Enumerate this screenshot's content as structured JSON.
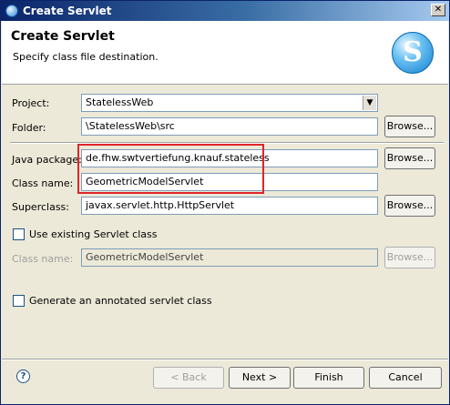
{
  "window": {
    "title": "Create Servlet"
  },
  "banner": {
    "heading": "Create Servlet",
    "description": "Specify class file destination."
  },
  "form": {
    "project": {
      "label": "Project:",
      "value": "StatelessWeb"
    },
    "folder": {
      "label": "Folder:",
      "value": "\\StatelessWeb\\src",
      "browse": "Browse..."
    },
    "package": {
      "label": "Java package:",
      "value": "de.fhw.swtvertiefung.knauf.stateless",
      "browse": "Browse..."
    },
    "class_name": {
      "label": "Class name:",
      "value": "GeometricModelServlet"
    },
    "superclass": {
      "label": "Superclass:",
      "value": "javax.servlet.http.HttpServlet",
      "browse": "Browse..."
    },
    "use_existing": {
      "label": "Use existing Servlet class",
      "checked": false
    },
    "existing_class": {
      "label": "Class name:",
      "value": "GeometricModelServlet",
      "browse": "Browse..."
    },
    "annotated": {
      "label": "Generate an annotated servlet class",
      "checked": false
    }
  },
  "buttons": {
    "back": "< Back",
    "next": "Next >",
    "finish": "Finish",
    "cancel": "Cancel"
  },
  "icons": {
    "help": "help-icon",
    "close": "close-icon",
    "logo": "servlet-logo-icon",
    "dropdown": "chevron-down-icon"
  },
  "colors": {
    "highlight": "#e0242b",
    "titlebar": "#0a246a"
  }
}
